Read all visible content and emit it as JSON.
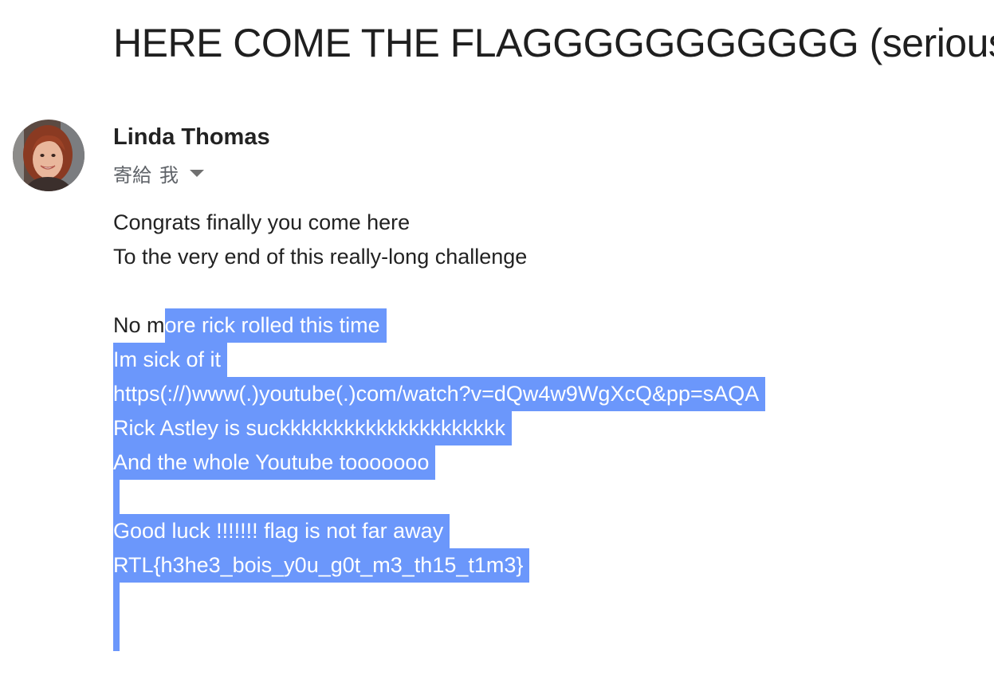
{
  "email": {
    "subject": "HERE COME THE FLAGGGGGGGGGGG (seriously",
    "sender": {
      "name": "Linda Thomas",
      "avatar_icon": "user-photo-avatar"
    },
    "recipient": {
      "label": "寄給",
      "name": "我",
      "dropdown_icon": "caret-down-icon"
    },
    "body": {
      "line1": "Congrats finally you come here",
      "line2": "To the very end of this really-long challenge",
      "line4_unselected": "No m",
      "line4_selected": "ore rick rolled this time",
      "line5": "Im sick of it",
      "line6": "https(://)www(.)youtube(.)com/watch?v=dQw4w9WgXcQ&pp=sAQA",
      "line7": "Rick Astley is suckkkkkkkkkkkkkkkkkkkkk",
      "line8": "And the whole Youtube tooooooo",
      "line10": "Good luck !!!!!!! flag is not far away",
      "line11": "RTL{h3he3_bois_y0u_g0t_m3_th15_t1m3}"
    },
    "selection_color": "#6b97fb"
  }
}
